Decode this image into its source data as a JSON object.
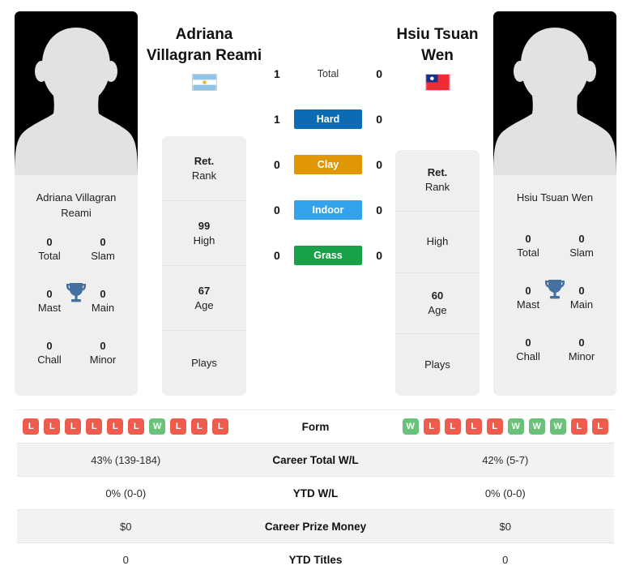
{
  "players": {
    "left": {
      "headline_name": "Adriana\nVillagran Reami",
      "headline_line1": "Adriana",
      "headline_line2": "Villagran Reami",
      "card_name": "Adriana Villagran Reami",
      "flag": "argentina-flag",
      "flag_country": "Argentina",
      "avatar": "player-silhouette",
      "titles": [
        {
          "value": "0",
          "label": "Total"
        },
        {
          "value": "0",
          "label": "Slam"
        },
        {
          "value": "0",
          "label": "Mast"
        },
        {
          "value": "0",
          "label": "Main"
        },
        {
          "value": "0",
          "label": "Chall"
        },
        {
          "value": "0",
          "label": "Minor"
        }
      ],
      "trophy_icon": "trophy-icon",
      "rank_stack": [
        {
          "value": "Ret.",
          "label": "Rank"
        },
        {
          "value": "99",
          "label": "High"
        },
        {
          "value": "67",
          "label": "Age"
        },
        {
          "value": "",
          "label": "Plays"
        }
      ],
      "form": [
        "L",
        "L",
        "L",
        "L",
        "L",
        "L",
        "W",
        "L",
        "L",
        "L"
      ]
    },
    "right": {
      "headline_line1": "Hsiu Tsuan",
      "headline_line2": "Wen",
      "card_name": "Hsiu Tsuan Wen",
      "flag": "taiwan-flag",
      "flag_country": "Taiwan",
      "avatar": "player-silhouette",
      "titles": [
        {
          "value": "0",
          "label": "Total"
        },
        {
          "value": "0",
          "label": "Slam"
        },
        {
          "value": "0",
          "label": "Mast"
        },
        {
          "value": "0",
          "label": "Main"
        },
        {
          "value": "0",
          "label": "Chall"
        },
        {
          "value": "0",
          "label": "Minor"
        }
      ],
      "trophy_icon": "trophy-icon",
      "rank_stack": [
        {
          "value": "Ret.",
          "label": "Rank"
        },
        {
          "value": "",
          "label": "High"
        },
        {
          "value": "60",
          "label": "Age"
        },
        {
          "value": "",
          "label": "Plays"
        }
      ],
      "form": [
        "W",
        "L",
        "L",
        "L",
        "L",
        "W",
        "W",
        "W",
        "L",
        "L"
      ]
    }
  },
  "head_to_head": {
    "surfaces": [
      {
        "label": "Total",
        "left": "1",
        "right": "0",
        "color": "none",
        "plain": true
      },
      {
        "label": "Hard",
        "left": "1",
        "right": "0",
        "color": "#0b6cb5",
        "plain": false
      },
      {
        "label": "Clay",
        "left": "0",
        "right": "0",
        "color": "#e09706",
        "plain": false
      },
      {
        "label": "Indoor",
        "left": "0",
        "right": "0",
        "color": "#33a3ee",
        "plain": false
      },
      {
        "label": "Grass",
        "left": "0",
        "right": "0",
        "color": "#18a148",
        "plain": false
      }
    ]
  },
  "stats_table": {
    "rows": [
      {
        "label": "Form",
        "type": "form",
        "left": "",
        "right": ""
      },
      {
        "label": "Career Total W/L",
        "type": "text",
        "left": "43% (139-184)",
        "right": "42% (5-7)"
      },
      {
        "label": "YTD W/L",
        "type": "text",
        "left": "0% (0-0)",
        "right": "0% (0-0)"
      },
      {
        "label": "Career Prize Money",
        "type": "text",
        "left": "$0",
        "right": "$0"
      },
      {
        "label": "YTD Titles",
        "type": "text",
        "left": "0",
        "right": "0"
      }
    ]
  },
  "colors": {
    "hard": "#0b6cb5",
    "clay": "#e09706",
    "indoor": "#33a3ee",
    "grass": "#18a148",
    "win_badge": "#6ac17a",
    "loss_badge": "#ef5b4c",
    "card_bg": "#efefef",
    "trophy": "#44719f"
  }
}
